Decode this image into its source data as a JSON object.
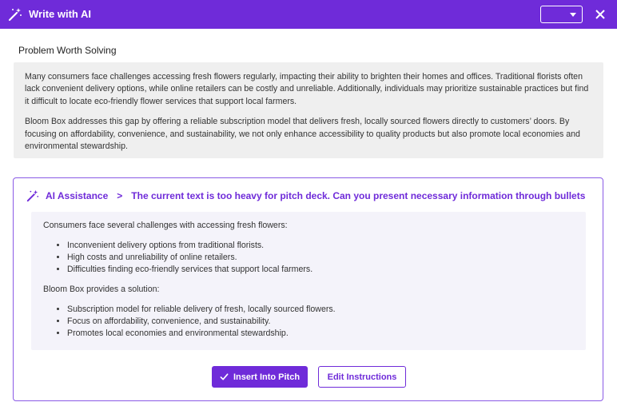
{
  "window": {
    "title": "Write with AI",
    "accent_color": "#6f2bd9",
    "dropdown_value": "",
    "icons": {
      "title": "magic-wand-icon",
      "dropdown": "caret-down-icon",
      "close": "close-icon"
    }
  },
  "section": {
    "heading": "Problem Worth Solving",
    "paragraphs": [
      "Many consumers face challenges accessing fresh flowers regularly, impacting their ability to brighten their homes and offices. Traditional florists often lack convenient delivery options, while online retailers can be costly and unreliable. Additionally, individuals may prioritize sustainable practices but find it difficult to locate eco-friendly flower services that support local farmers.",
      "Bloom Box addresses this gap by offering a reliable subscription model that delivers fresh, locally sourced flowers directly to customers’ doors. By focusing on affordability, convenience, and sustainability, we not only enhance accessibility to quality products but also promote local economies and environmental stewardship."
    ]
  },
  "assistant": {
    "label": "AI Assistance",
    "separator": ">",
    "prompt": "The current text is too heavy for pitch deck. Can you present necessary information through bullets",
    "result": {
      "intro1": "Consumers face several challenges with accessing fresh flowers:",
      "bullets1": [
        "Inconvenient delivery options from traditional florists.",
        "High costs and unreliability of online retailers.",
        "Difficulties finding eco-friendly services that support local farmers."
      ],
      "intro2": "Bloom Box provides a solution:",
      "bullets2": [
        "Subscription model for reliable delivery of fresh, locally sourced flowers.",
        "Focus on affordability, convenience, and sustainability.",
        "Promotes local economies and environmental stewardship."
      ]
    },
    "buttons": {
      "insert": "Insert Into Pitch",
      "edit": "Edit Instructions"
    }
  }
}
